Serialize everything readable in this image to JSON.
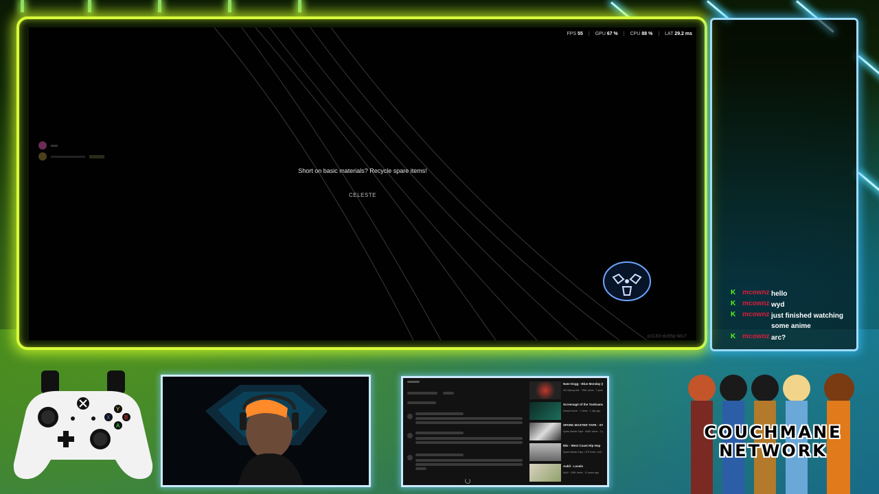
{
  "game": {
    "perf": {
      "fps_label": "FPS",
      "fps": "55",
      "gpu_label": "GPU",
      "gpu": "67 %",
      "cpu_label": "CPU",
      "cpu": "88 %",
      "lat_label": "LAT",
      "lat": "29.2 ms"
    },
    "loading_tip": "Short on basic materials? Recycle spare items!",
    "loading_name": "CELESTE",
    "session_id": "p3183-dx95p-lklv7"
  },
  "chat": {
    "messages": [
      {
        "user": "mcownz",
        "text": "hello"
      },
      {
        "user": "mcownz",
        "text": "wyd"
      },
      {
        "user": "mcownz",
        "text": "just finished watching some anime"
      },
      {
        "user": "mcownz",
        "text": "arc?"
      }
    ],
    "badge_glyph": "K",
    "badge_color": "#53fc18",
    "username_color": "#d81e3b"
  },
  "browser": {
    "videos": [
      {
        "title": "Nate Dogg - Blue Monday (HD Audio)",
        "meta": "HD Hiphopvids · 735K views · 7 years ago"
      },
      {
        "title": "Screenagé of the Tooknama slot Hako",
        "meta": "Zhaoki house · 7 views · 1 day ago"
      },
      {
        "title": "SPARK MASTER TAPE - STNDBY (OFFICIAL FAN ...",
        "meta": "Spark Master Tape · 846K views · 1 year ago"
      },
      {
        "title": "Mix - West Coast Hip Hop",
        "meta": "Spark Master Tape, UTR Index, Sub..."
      },
      {
        "title": "Aukli - Levels",
        "meta": "Aukli · 156K views · 10 years ago"
      }
    ]
  },
  "logo": {
    "line1": "COUCHMANE",
    "line2": "NETWORK"
  },
  "colors": {
    "game_border": "#d8ff3a",
    "chat_border": "#9fdcff"
  }
}
